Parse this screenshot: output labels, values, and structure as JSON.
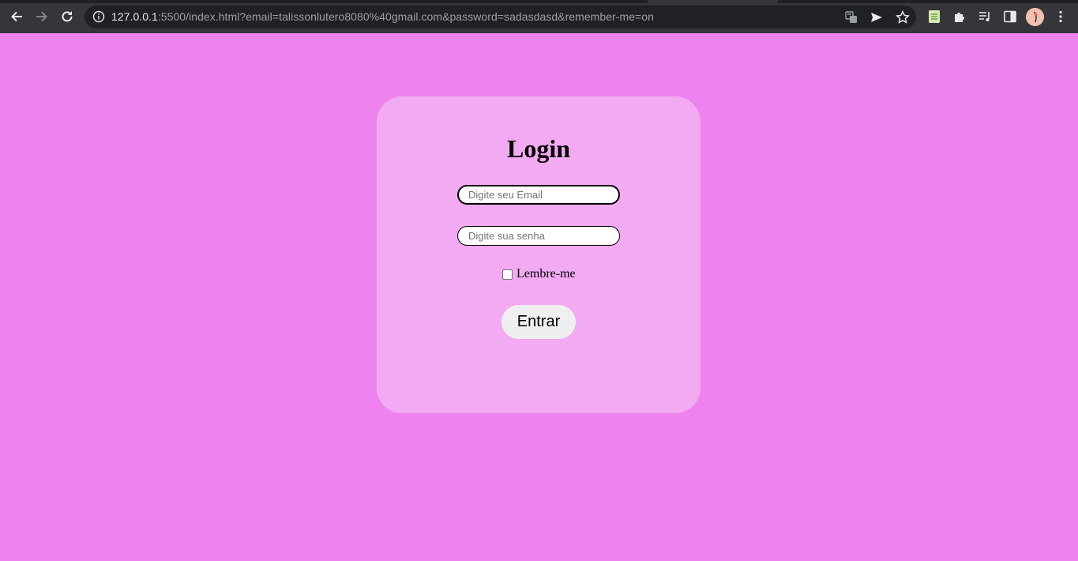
{
  "browser": {
    "url_host": "127.0.0.1",
    "url_rest": ":5500/index.html?email=talissonlutero8080%40gmail.com&password=sadasdasd&remember-me=on",
    "icons": {
      "back": "arrow-left-icon",
      "forward": "arrow-right-icon",
      "reload": "reload-icon",
      "site_info": "info-icon",
      "translate": "translate-icon",
      "send": "send-icon",
      "bookmark": "star-icon",
      "extension_sheet": "sheet-extension-icon",
      "extensions": "puzzle-icon",
      "media": "media-queue-icon",
      "side_panel": "side-panel-icon",
      "profile": "avatar",
      "menu": "kebab-menu-icon"
    }
  },
  "login": {
    "title": "Login",
    "email_placeholder": "Digite seu Email",
    "password_placeholder": "Digite sua senha",
    "remember_label": "Lembre-me",
    "submit_label": "Entrar"
  },
  "colors": {
    "page_background": "#ee82ee",
    "card_background": "#f2aaf2",
    "chrome_background": "#35363a",
    "button_background": "#efefef"
  }
}
